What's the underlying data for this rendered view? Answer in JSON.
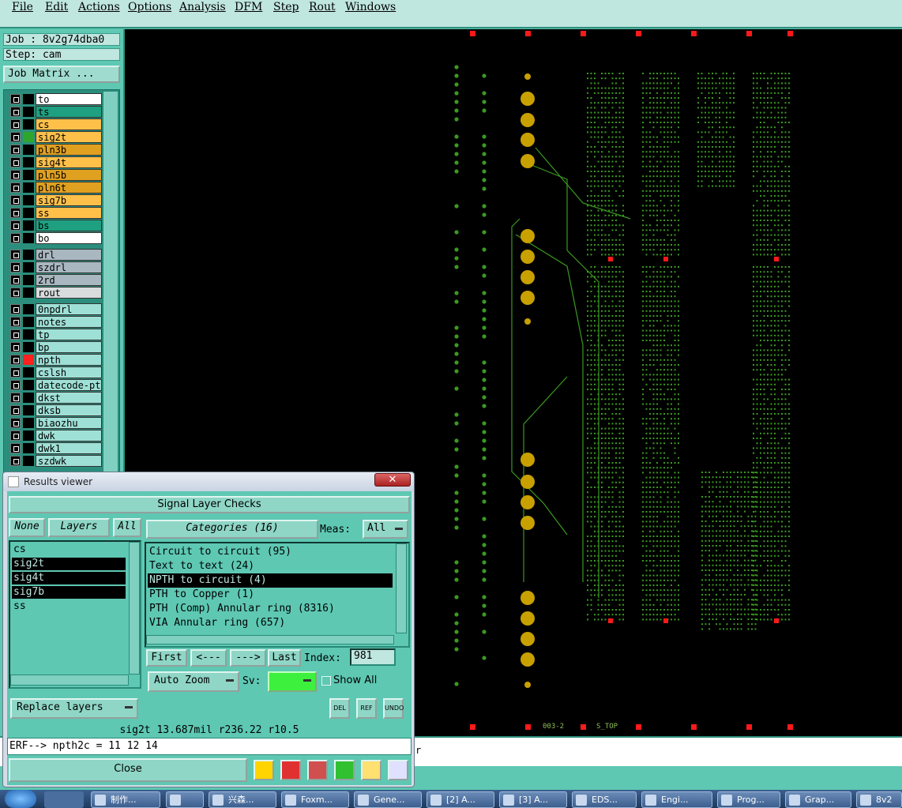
{
  "menu": [
    "File",
    "Edit",
    "Actions",
    "Options",
    "Analysis",
    "DFM",
    "Step",
    "Rout",
    "Windows"
  ],
  "job": {
    "job_label": "Job : 8v2g74dba0",
    "step_label": "Step: cam",
    "matrix_button": "Job Matrix ..."
  },
  "layers_group1": [
    {
      "name": "to",
      "color": "#ffffff",
      "swatch": ""
    },
    {
      "name": "ts",
      "color": "#1fa080",
      "swatch": ""
    },
    {
      "name": "cs",
      "color": "#ffc04a",
      "swatch": ""
    },
    {
      "name": "sig2t",
      "color": "#ffc04a",
      "swatch": "#2ea62e"
    },
    {
      "name": "pln3b",
      "color": "#e0a020",
      "swatch": ""
    },
    {
      "name": "sig4t",
      "color": "#ffc04a",
      "swatch": ""
    },
    {
      "name": "pln5b",
      "color": "#e0a020",
      "swatch": ""
    },
    {
      "name": "pln6t",
      "color": "#e0a020",
      "swatch": ""
    },
    {
      "name": "sig7b",
      "color": "#ffc04a",
      "swatch": ""
    },
    {
      "name": "ss",
      "color": "#ffc04a",
      "swatch": ""
    },
    {
      "name": "bs",
      "color": "#1fa080",
      "swatch": ""
    },
    {
      "name": "bo",
      "color": "#ffffff",
      "swatch": ""
    }
  ],
  "layers_group2": [
    {
      "name": "drl",
      "color": "#a9b8c0"
    },
    {
      "name": "szdrl",
      "color": "#a9b8c0"
    },
    {
      "name": "2rd",
      "color": "#a9b8c0"
    },
    {
      "name": "rout",
      "color": "#d8dcdc"
    }
  ],
  "layers_group3": [
    {
      "name": "0npdrl",
      "color": "#9fe0d6",
      "swatch": ""
    },
    {
      "name": "notes",
      "color": "#9fe0d6",
      "swatch": ""
    },
    {
      "name": "tp",
      "color": "#9fe0d6",
      "swatch": ""
    },
    {
      "name": "bp",
      "color": "#9fe0d6",
      "swatch": ""
    },
    {
      "name": "npth",
      "color": "#9fe0d6",
      "swatch": "#ff2020"
    },
    {
      "name": "cslsh",
      "color": "#9fe0d6",
      "swatch": ""
    },
    {
      "name": "datecode-ptc",
      "color": "#9fe0d6",
      "swatch": ""
    },
    {
      "name": "dkst",
      "color": "#9fe0d6",
      "swatch": ""
    },
    {
      "name": "dksb",
      "color": "#9fe0d6",
      "swatch": ""
    },
    {
      "name": "biaozhu",
      "color": "#9fe0d6",
      "swatch": ""
    },
    {
      "name": "dwk",
      "color": "#9fe0d6",
      "swatch": ""
    },
    {
      "name": "dwk1",
      "color": "#9fe0d6",
      "swatch": ""
    },
    {
      "name": "szdwk",
      "color": "#9fe0d6",
      "swatch": ""
    }
  ],
  "canvas_labels": {
    "label1": "003-2",
    "label2": "S_TOP"
  },
  "results_viewer": {
    "window_title": "Results viewer",
    "close_x": "✕",
    "header": "Signal Layer Checks",
    "btn_none": "None",
    "btn_layers": "Layers",
    "btn_all": "All",
    "layers_list": [
      {
        "name": "cs",
        "selected": false
      },
      {
        "name": "sig2t",
        "selected": true
      },
      {
        "name": "sig4t",
        "selected": true
      },
      {
        "name": "sig7b",
        "selected": true
      },
      {
        "name": "ss",
        "selected": false
      }
    ],
    "categories_label": "Categories (16)",
    "meas_label": "Meas:",
    "meas_value": "All",
    "categories": [
      {
        "text": "Circuit to circuit (95)",
        "selected": false
      },
      {
        "text": "Text to text (24)",
        "selected": false
      },
      {
        "text": "NPTH to circuit (4)",
        "selected": true
      },
      {
        "text": "PTH to Copper (1)",
        "selected": false
      },
      {
        "text": "PTH (Comp) Annular ring (8316)",
        "selected": false
      },
      {
        "text": "VIA Annular ring (657)",
        "selected": false
      }
    ],
    "nav": {
      "first": "First",
      "prev": "<---",
      "next": "--->",
      "last": "Last",
      "index_label": "Index:",
      "index_value": "981"
    },
    "auto_zoom": "Auto Zoom",
    "sv_label": "Sv:",
    "show_all": "Show All",
    "replace_layers": "Replace layers",
    "icon_del": "DEL",
    "icon_ref": "REF",
    "icon_undo": "UNDO",
    "info_line": "sig2t 13.687mil  r236.22  r10.5",
    "erf_line": "ERF--> npth2c = 11 12 14",
    "close": "Close"
  },
  "status": {
    "trailing": "r"
  },
  "taskbar": [
    "制作...",
    "",
    "兴森...",
    "Foxm...",
    "Gene...",
    "[2] A...",
    "[3] A...",
    "EDS...",
    "Engi...",
    "Prog...",
    "Grap...",
    "8v2"
  ],
  "colors": {
    "bg": "#5ec8b3",
    "panel_light": "#bfe6df",
    "copper": "#c8a000",
    "trace": "#3a9a20",
    "marker": "#ff1a1a"
  }
}
